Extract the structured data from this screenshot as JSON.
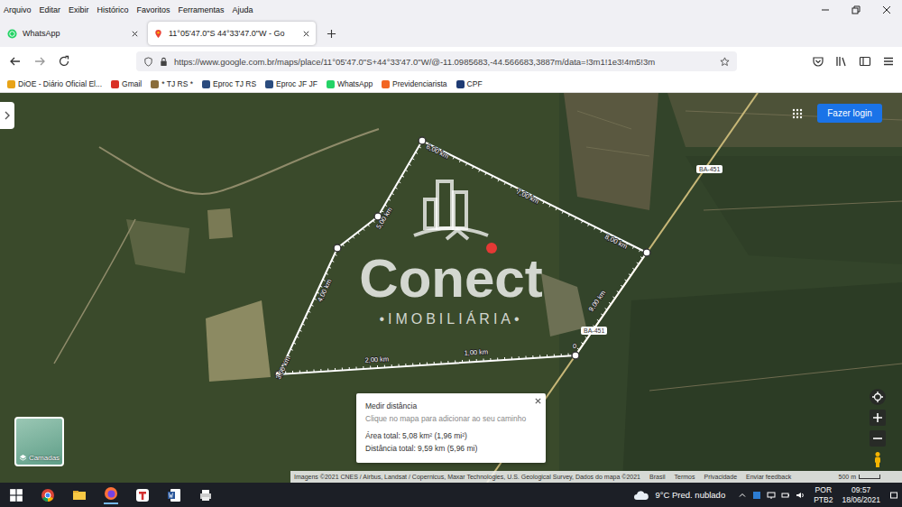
{
  "menu": [
    "Arquivo",
    "Editar",
    "Exibir",
    "Histórico",
    "Favoritos",
    "Ferramentas",
    "Ajuda"
  ],
  "tabs": [
    {
      "label": "WhatsApp",
      "selected": false
    },
    {
      "label": "11°05'47.0\"S 44°33'47.0\"W - Go",
      "selected": true
    }
  ],
  "address_bar": {
    "url": "https://www.google.com.br/maps/place/11°05'47.0\"S+44°33'47.0\"W/@-11.0985683,-44.566683,3887m/data=!3m1!1e3!4m5!3m"
  },
  "bookmarks": [
    {
      "label": "DiOE - Diário Oficial El...",
      "color": "#e8a317"
    },
    {
      "label": "Gmail",
      "color": "#d93025"
    },
    {
      "label": "* TJ RS *",
      "color": "#8a6d3b"
    },
    {
      "label": "Eproc TJ RS",
      "color": "#2b4c7e"
    },
    {
      "label": "Eproc JF JF",
      "color": "#2b4c7e"
    },
    {
      "label": "WhatsApp",
      "color": "#25d366"
    },
    {
      "label": "Previdenciarista",
      "color": "#f26522"
    },
    {
      "label": "CPF",
      "color": "#1f3b73"
    }
  ],
  "map": {
    "distance_markers": [
      "0",
      "1,00 km",
      "2,00 km",
      "3,00 km",
      "4,00 km",
      "5,00 km",
      "6,00 km",
      "7,00 km",
      "8,00 km",
      "9,00 km"
    ],
    "roads": [
      "BA-451",
      "BA-451"
    ],
    "watermark": {
      "name": "Conect",
      "subtitle": "•IMOBILIÁRIA•"
    },
    "login": "Fazer login",
    "measure": {
      "title": "Medir distância",
      "hint": "Clique no mapa para adicionar ao seu caminho",
      "area": "Área total: 5,08 km² (1,96 mi²)",
      "distance": "Distância total: 9,59 km (5,96 mi)"
    },
    "layers": "Camadas",
    "attribution": "Imagens ©2021 CNES / Airbus, Landsat / Copernicus, Maxar Technologies, U.S. Geological Survey, Dados do mapa ©2021",
    "footer_links": [
      "Brasil",
      "Termos",
      "Privacidade",
      "Enviar feedback"
    ],
    "scale": "500 m"
  },
  "taskbar": {
    "weather": "9°C",
    "forecast": "Pred. nublado",
    "language": [
      "POR",
      "PTB2"
    ],
    "time": "09:57",
    "date": "18/06/2021"
  }
}
